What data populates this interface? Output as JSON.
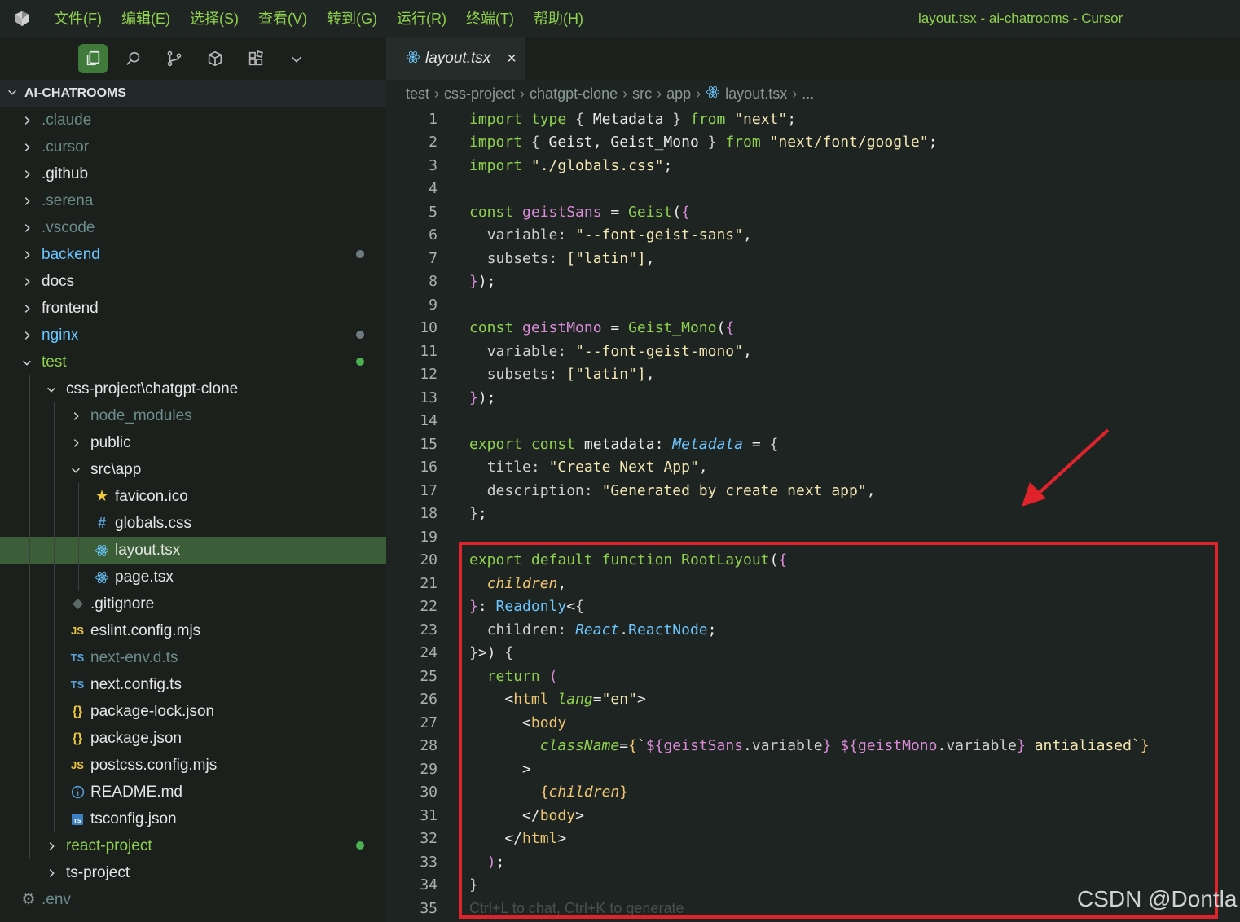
{
  "menubar": {
    "items": [
      "文件(F)",
      "编辑(E)",
      "选择(S)",
      "查看(V)",
      "转到(G)",
      "运行(R)",
      "终端(T)",
      "帮助(H)"
    ],
    "window_title": "layout.tsx - ai-chatrooms - Cursor"
  },
  "sidebar": {
    "activity_icons": [
      "files-icon",
      "search-icon",
      "source-control-icon",
      "extensions-cube-icon",
      "extensions-grid-icon",
      "chevron-down-icon"
    ],
    "explorer_title": "AI-CHATROOMS",
    "tree": [
      {
        "label": ".claude",
        "depth": 0,
        "type": "folder",
        "open": false,
        "color": "dim"
      },
      {
        "label": ".cursor",
        "depth": 0,
        "type": "folder",
        "open": false,
        "color": "dim"
      },
      {
        "label": ".github",
        "depth": 0,
        "type": "folder",
        "open": false,
        "color": "white"
      },
      {
        "label": ".serena",
        "depth": 0,
        "type": "folder",
        "open": false,
        "color": "dim"
      },
      {
        "label": ".vscode",
        "depth": 0,
        "type": "folder",
        "open": false,
        "color": "dim"
      },
      {
        "label": "backend",
        "depth": 0,
        "type": "folder",
        "open": false,
        "color": "blue",
        "dot": "gray"
      },
      {
        "label": "docs",
        "depth": 0,
        "type": "folder",
        "open": false,
        "color": "white"
      },
      {
        "label": "frontend",
        "depth": 0,
        "type": "folder",
        "open": false,
        "color": "white"
      },
      {
        "label": "nginx",
        "depth": 0,
        "type": "folder",
        "open": false,
        "color": "blue",
        "dot": "gray"
      },
      {
        "label": "test",
        "depth": 0,
        "type": "folder",
        "open": true,
        "color": "green",
        "dot": "green"
      },
      {
        "label": "css-project\\chatgpt-clone",
        "depth": 1,
        "type": "folder",
        "open": true,
        "color": "white"
      },
      {
        "label": "node_modules",
        "depth": 2,
        "type": "folder",
        "open": false,
        "color": "dim"
      },
      {
        "label": "public",
        "depth": 2,
        "type": "folder",
        "open": false,
        "color": "white"
      },
      {
        "label": "src\\app",
        "depth": 2,
        "type": "folder",
        "open": true,
        "color": "white"
      },
      {
        "label": "favicon.ico",
        "depth": 3,
        "type": "file",
        "icon": "star",
        "color": "white"
      },
      {
        "label": "globals.css",
        "depth": 3,
        "type": "file",
        "icon": "hash",
        "color": "white"
      },
      {
        "label": "layout.tsx",
        "depth": 3,
        "type": "file",
        "icon": "react",
        "color": "white",
        "selected": true
      },
      {
        "label": "page.tsx",
        "depth": 3,
        "type": "file",
        "icon": "react",
        "color": "white"
      },
      {
        "label": ".gitignore",
        "depth": 2,
        "type": "file",
        "icon": "git",
        "color": "white"
      },
      {
        "label": "eslint.config.mjs",
        "depth": 2,
        "type": "file",
        "icon": "JS",
        "color": "white"
      },
      {
        "label": "next-env.d.ts",
        "depth": 2,
        "type": "file",
        "icon": "TS",
        "color": "dim"
      },
      {
        "label": "next.config.ts",
        "depth": 2,
        "type": "file",
        "icon": "TS",
        "color": "white"
      },
      {
        "label": "package-lock.json",
        "depth": 2,
        "type": "file",
        "icon": "{}",
        "color": "white"
      },
      {
        "label": "package.json",
        "depth": 2,
        "type": "file",
        "icon": "{}",
        "color": "white"
      },
      {
        "label": "postcss.config.mjs",
        "depth": 2,
        "type": "file",
        "icon": "JS",
        "color": "white"
      },
      {
        "label": "README.md",
        "depth": 2,
        "type": "file",
        "icon": "info",
        "color": "white"
      },
      {
        "label": "tsconfig.json",
        "depth": 2,
        "type": "file",
        "icon": "tsconfig",
        "color": "white"
      },
      {
        "label": "react-project",
        "depth": 1,
        "type": "folder",
        "open": false,
        "color": "green",
        "dot": "green"
      },
      {
        "label": "ts-project",
        "depth": 1,
        "type": "folder",
        "open": false,
        "color": "white"
      },
      {
        "label": ".env",
        "depth": 0,
        "type": "file",
        "icon": "gear",
        "color": "dim"
      }
    ]
  },
  "tabs": [
    {
      "label": "layout.tsx",
      "icon": "react-icon",
      "close": "×"
    }
  ],
  "breadcrumb": [
    "test",
    "css-project",
    "chatgpt-clone",
    "src",
    "app",
    "layout.tsx",
    "..."
  ],
  "editor": {
    "line_numbers": [
      "1",
      "2",
      "3",
      "4",
      "5",
      "6",
      "7",
      "8",
      "9",
      "10",
      "11",
      "12",
      "13",
      "14",
      "15",
      "16",
      "17",
      "18",
      "19",
      "20",
      "21",
      "22",
      "23",
      "24",
      "25",
      "26",
      "27",
      "28",
      "29",
      "30",
      "31",
      "32",
      "33",
      "34",
      "35"
    ],
    "hint": "Ctrl+L to chat, Ctrl+K to generate"
  },
  "watermark": "CSDN @Dontla",
  "colors": {
    "accent": "#8fd14f",
    "highlight": "#e0232b",
    "selection": "#3b5e38",
    "dot_green": "#4caf50",
    "dot_gray": "#6d7b80"
  }
}
